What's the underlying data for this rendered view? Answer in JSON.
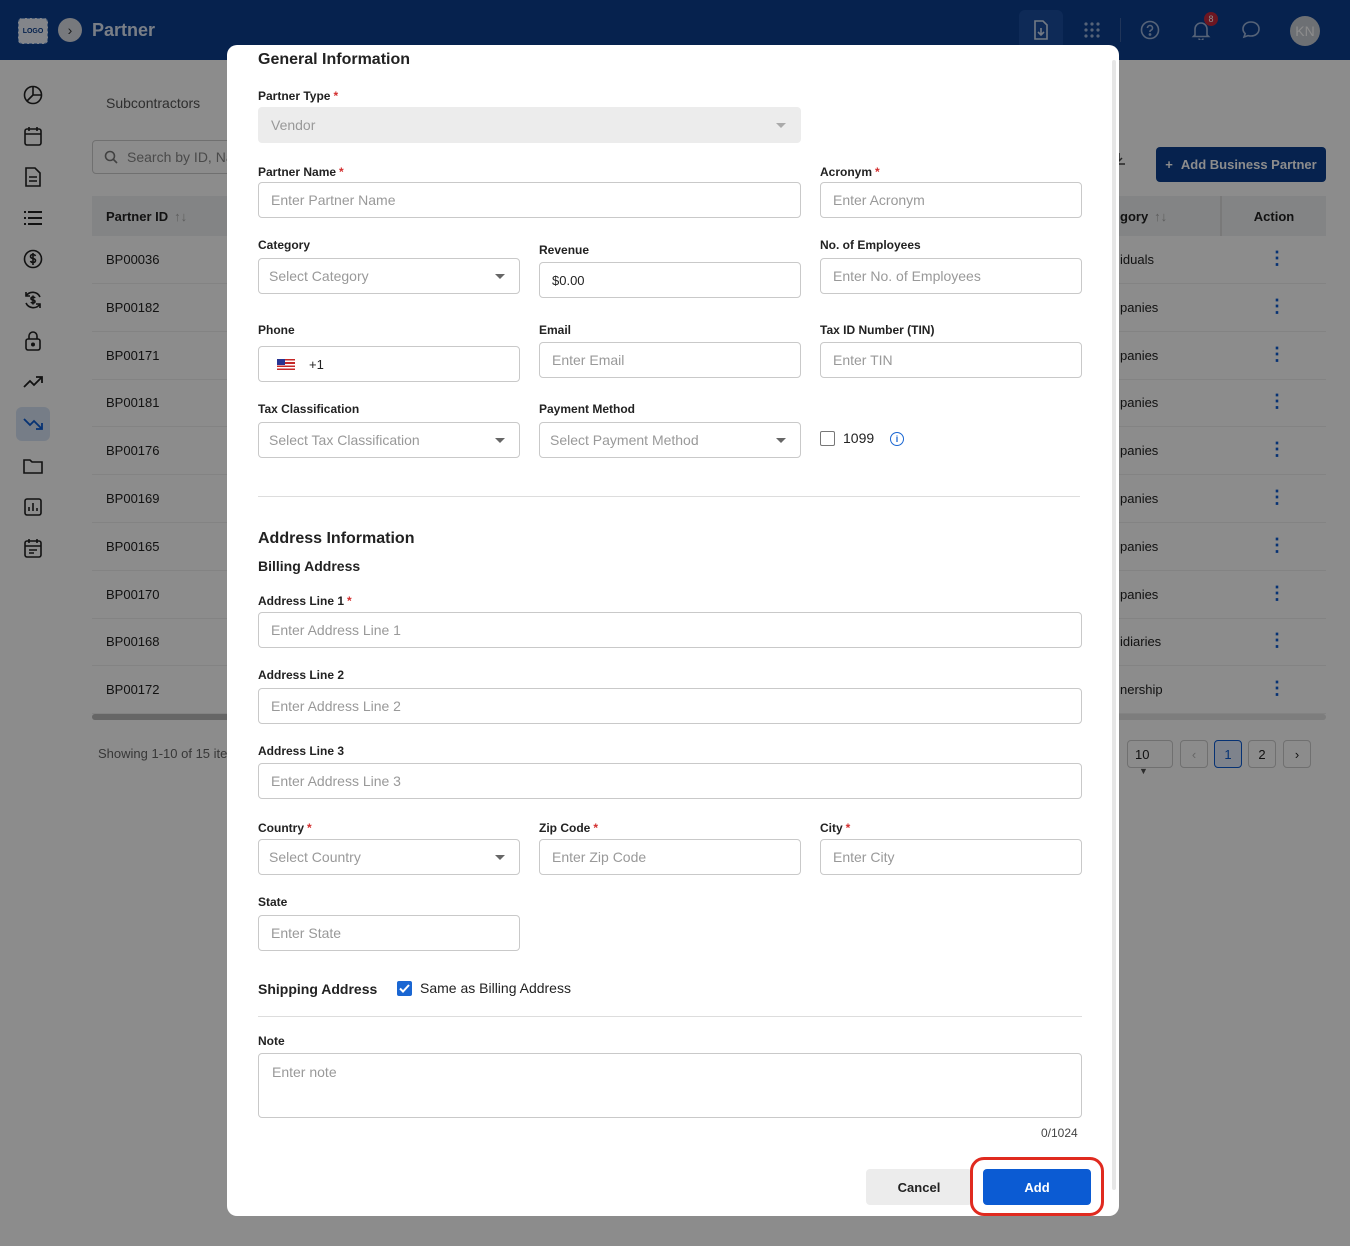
{
  "header": {
    "logo": "LOGO",
    "title": "Partner",
    "notification_count": "8",
    "avatar_initials": "KN"
  },
  "background": {
    "tab": "Subcontractors",
    "search_placeholder": "Search by ID, Na",
    "add_button": "Add Business Partner",
    "columns": {
      "partner_id": "Partner ID",
      "category": "gory",
      "action": "Action"
    },
    "rows": [
      {
        "id": "BP00036",
        "category": "iduals"
      },
      {
        "id": "BP00182",
        "category": "panies"
      },
      {
        "id": "BP00171",
        "category": "panies"
      },
      {
        "id": "BP00181",
        "category": "panies"
      },
      {
        "id": "BP00176",
        "category": "panies"
      },
      {
        "id": "BP00169",
        "category": "panies"
      },
      {
        "id": "BP00165",
        "category": "panies"
      },
      {
        "id": "BP00170",
        "category": "panies"
      },
      {
        "id": "BP00168",
        "category": "idiaries"
      },
      {
        "id": "BP00172",
        "category": "nership"
      }
    ],
    "showing": "Showing 1-10 of 15 ite",
    "page_size": "10",
    "pages": [
      "1",
      "2"
    ]
  },
  "modal": {
    "general_title": "General Information",
    "partner_type": {
      "label": "Partner Type",
      "value": "Vendor"
    },
    "partner_name": {
      "label": "Partner Name",
      "placeholder": "Enter Partner Name"
    },
    "acronym": {
      "label": "Acronym",
      "placeholder": "Enter Acronym"
    },
    "category": {
      "label": "Category",
      "placeholder": "Select Category"
    },
    "revenue": {
      "label": "Revenue",
      "value": "$0.00"
    },
    "employees": {
      "label": "No. of Employees",
      "placeholder": "Enter No. of Employees"
    },
    "phone": {
      "label": "Phone",
      "value": "+1"
    },
    "email": {
      "label": "Email",
      "placeholder": "Enter Email"
    },
    "tin": {
      "label": "Tax ID Number (TIN)",
      "placeholder": "Enter TIN"
    },
    "tax_classification": {
      "label": "Tax Classification",
      "placeholder": "Select Tax Classification"
    },
    "payment_method": {
      "label": "Payment Method",
      "placeholder": "Select Payment Method"
    },
    "form_1099": {
      "label": "1099",
      "checked": false
    },
    "address_title": "Address Information",
    "billing_title": "Billing Address",
    "address1": {
      "label": "Address Line 1",
      "placeholder": "Enter Address Line 1"
    },
    "address2": {
      "label": "Address Line 2",
      "placeholder": "Enter Address Line 2"
    },
    "address3": {
      "label": "Address Line 3",
      "placeholder": "Enter Address Line 3"
    },
    "country": {
      "label": "Country",
      "placeholder": "Select Country"
    },
    "zip": {
      "label": "Zip Code",
      "placeholder": "Enter Zip Code"
    },
    "city": {
      "label": "City",
      "placeholder": "Enter City"
    },
    "state": {
      "label": "State",
      "placeholder": "Enter State"
    },
    "shipping_title": "Shipping Address",
    "same_as_billing": {
      "label": "Same as Billing Address",
      "checked": true
    },
    "note": {
      "label": "Note",
      "placeholder": "Enter note",
      "counter": "0/1024"
    },
    "cancel_label": "Cancel",
    "add_label": "Add"
  },
  "colors": {
    "header_bg": "#0b3e8f",
    "primary": "#0b5bd3",
    "required": "#d32f2f",
    "highlight": "#e02a1f"
  }
}
